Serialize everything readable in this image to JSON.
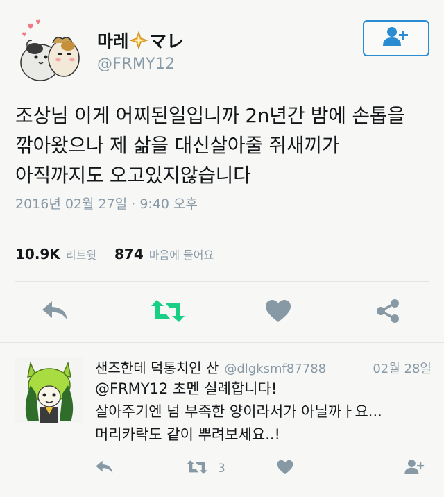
{
  "user": {
    "name_part1": "마레",
    "name_part2": "マレ",
    "handle": "@FRMY12"
  },
  "tweet": {
    "text_line1": "조상님 이게 어찌된일입니까 2n년간 밤에 손톱을",
    "text_line2": "깎아왔으나 제 삶을 대신살아줄 쥐새끼가",
    "text_line3": "아직까지도 오고있지않습니다",
    "timestamp": "2016년 02월 27일 · 9:40 오후"
  },
  "stats": {
    "retweets_count": "10.9K",
    "retweets_label": "리트윗",
    "likes_count": "874",
    "likes_label": "마음에 들어요"
  },
  "reply": {
    "name": "샌즈한테 덕통치인 산",
    "handle": "@dlgksmf87788",
    "date": "02월 28일",
    "line1": "@FRMY12 초멘 실례합니다!",
    "line2": "살아주기엔 넘 부족한 양이라서가 아닐까ㅏ요...",
    "line3": "머리카락도 같이 뿌려보세요..!",
    "retweet_count": "3"
  },
  "colors": {
    "accent": "#2b8dd1",
    "retweet_green": "#19cf86",
    "icon_gray": "#8899a6",
    "text": "#14171a"
  },
  "icons": {
    "follow": "add-user-icon",
    "reply": "reply-icon",
    "retweet": "retweet-icon",
    "like": "heart-icon",
    "share": "share-icon"
  }
}
